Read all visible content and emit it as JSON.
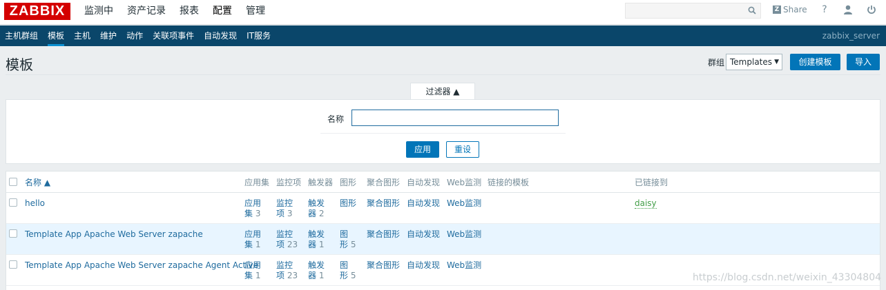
{
  "logo": "ZABBIX",
  "main_menu": [
    "监测中",
    "资产记录",
    "报表",
    "配置",
    "管理"
  ],
  "header_right": {
    "share": "Share",
    "help": "?",
    "user": "user-icon",
    "power": "power-icon"
  },
  "sub_menu": [
    "主机群组",
    "模板",
    "主机",
    "维护",
    "动作",
    "关联项事件",
    "自动发现",
    "IT服务"
  ],
  "server_name": "zabbix_server",
  "page_title": "模板",
  "group_label": "群组",
  "group_value": "Templates",
  "create_button": "创建模板",
  "import_button": "导入",
  "filter": {
    "tab_label": "过滤器 ▲",
    "name_label": "名称",
    "name_value": "",
    "apply": "应用",
    "reset": "重设"
  },
  "table": {
    "headers": {
      "name": "名称 ▲",
      "apps": "应用集",
      "items": "监控项",
      "triggers": "触发器",
      "graphs": "图形",
      "screens": "聚合图形",
      "discovery": "自动发现",
      "web": "Web监测",
      "linked_templates": "链接的模板",
      "linked_to": "已链接到"
    },
    "rows": [
      {
        "name": "hello",
        "apps_a": "应用",
        "apps_b": "集",
        "apps_count": "3",
        "items_a": "监控",
        "items_b": "项",
        "items_count": "3",
        "triggers_a": "触发",
        "triggers_b": "器",
        "triggers_count": "2",
        "graphs_a": "图形",
        "graphs_b": "",
        "graphs_count": "",
        "screens": "聚合图形",
        "discovery": "自动发现",
        "web": "Web监测",
        "linked_to": "daisy"
      },
      {
        "name": "Template App Apache Web Server zapache",
        "apps_a": "应用",
        "apps_b": "集",
        "apps_count": "1",
        "items_a": "监控",
        "items_b": "项",
        "items_count": "23",
        "triggers_a": "触发",
        "triggers_b": "器",
        "triggers_count": "1",
        "graphs_a": "图",
        "graphs_b": "形",
        "graphs_count": "5",
        "screens": "聚合图形",
        "discovery": "自动发现",
        "web": "Web监测",
        "linked_to": ""
      },
      {
        "name": "Template App Apache Web Server zapache Agent Active",
        "apps_a": "应用",
        "apps_b": "集",
        "apps_count": "1",
        "items_a": "监控",
        "items_b": "项",
        "items_count": "23",
        "triggers_a": "触发",
        "triggers_b": "器",
        "triggers_count": "1",
        "graphs_a": "图",
        "graphs_b": "形",
        "graphs_count": "5",
        "screens": "聚合图形",
        "discovery": "自动发现",
        "web": "Web监测",
        "linked_to": ""
      }
    ]
  },
  "watermark": "https://blog.csdn.net/weixin_43304804"
}
